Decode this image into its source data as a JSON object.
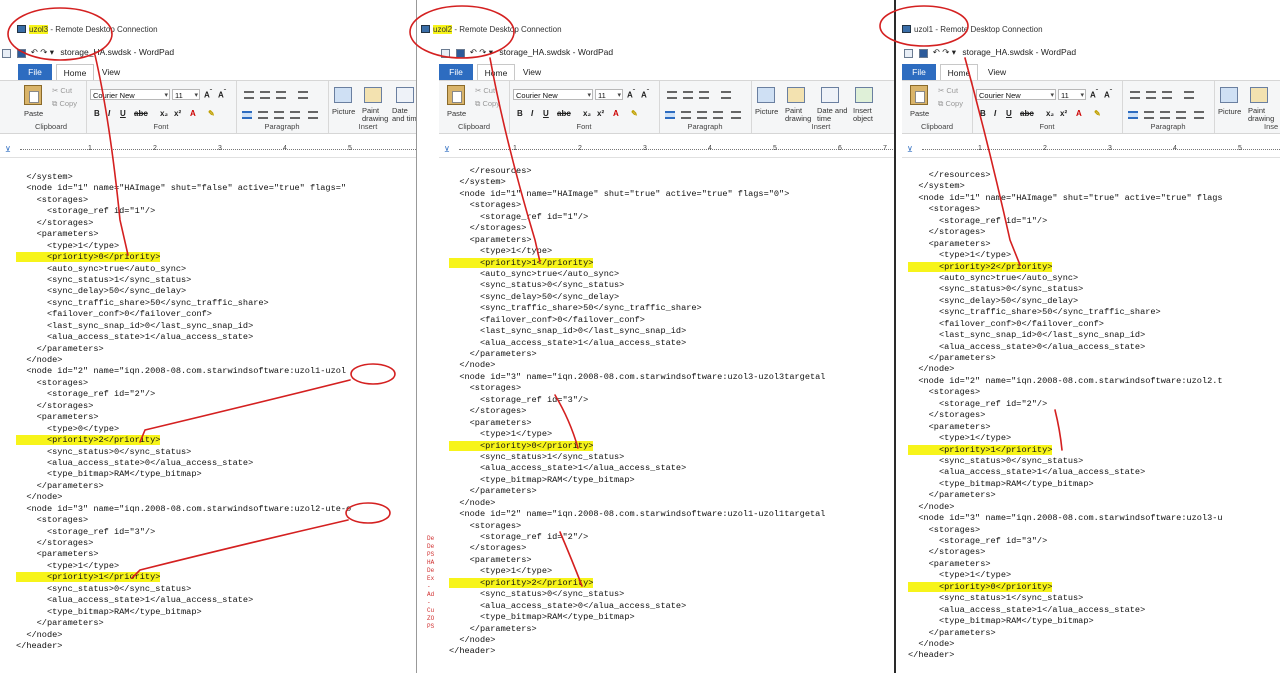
{
  "windows": [
    {
      "id": "w1",
      "rdp_title_host": "uzol3",
      "rdp_title_rest": " - Remote Desktop Connection",
      "wordpad_title": "storage_HA.swdsk - WordPad",
      "tabs": {
        "file": "File",
        "home": "Home",
        "view": "View"
      },
      "ribbon": {
        "clipboard": {
          "paste": "Paste",
          "cut": "Cut",
          "copy": "Copy",
          "label": "Clipboard"
        },
        "font": {
          "name": "Courier New",
          "size": "11",
          "label": "Font"
        },
        "paragraph": {
          "label": "Paragraph"
        },
        "insert": {
          "picture": "Picture",
          "paint": "Paint drawing",
          "datetime": "Date and time",
          "label": "Insert"
        }
      },
      "ruler_numbers": [
        "1",
        "2",
        "3",
        "4",
        "5"
      ],
      "lines": [
        {
          "text": "  </system>",
          "hl": false
        },
        {
          "text": "  <node id=\"1\" name=\"HAImage\" shut=\"false\" active=\"true\" flags=\"",
          "hl": false
        },
        {
          "text": "    <storages>",
          "hl": false
        },
        {
          "text": "      <storage_ref id=\"1\"/>",
          "hl": false
        },
        {
          "text": "    </storages>",
          "hl": false
        },
        {
          "text": "    <parameters>",
          "hl": false
        },
        {
          "text": "      <type>1</type>",
          "hl": false
        },
        {
          "text": "      <priority>0</priority>",
          "hl": true
        },
        {
          "text": "      <auto_sync>true</auto_sync>",
          "hl": false
        },
        {
          "text": "      <sync_status>1</sync_status>",
          "hl": false
        },
        {
          "text": "      <sync_delay>50</sync_delay>",
          "hl": false
        },
        {
          "text": "      <sync_traffic_share>50</sync_traffic_share>",
          "hl": false
        },
        {
          "text": "      <failover_conf>0</failover_conf>",
          "hl": false
        },
        {
          "text": "      <last_sync_snap_id>0</last_sync_snap_id>",
          "hl": false
        },
        {
          "text": "      <alua_access_state>1</alua_access_state>",
          "hl": false
        },
        {
          "text": "    </parameters>",
          "hl": false
        },
        {
          "text": "  </node>",
          "hl": false
        },
        {
          "text": "  <node id=\"2\" name=\"iqn.2008-08.com.starwindsoftware:uzol1-uzol",
          "hl": false
        },
        {
          "text": "    <storages>",
          "hl": false
        },
        {
          "text": "      <storage_ref id=\"2\"/>",
          "hl": false
        },
        {
          "text": "    </storages>",
          "hl": false
        },
        {
          "text": "    <parameters>",
          "hl": false
        },
        {
          "text": "      <type>0</type>",
          "hl": false
        },
        {
          "text": "      <priority>2</priority>",
          "hl": true
        },
        {
          "text": "      <sync_status>0</sync_status>",
          "hl": false
        },
        {
          "text": "      <alua_access_state>0</alua_access_state>",
          "hl": false
        },
        {
          "text": "      <type_bitmap>RAM</type_bitmap>",
          "hl": false
        },
        {
          "text": "    </parameters>",
          "hl": false
        },
        {
          "text": "  </node>",
          "hl": false
        },
        {
          "text": "  <node id=\"3\" name=\"iqn.2008-08.com.starwindsoftware:uzol2-ute-o",
          "hl": false
        },
        {
          "text": "    <storages>",
          "hl": false
        },
        {
          "text": "      <storage_ref id=\"3\"/>",
          "hl": false
        },
        {
          "text": "    </storages>",
          "hl": false
        },
        {
          "text": "    <parameters>",
          "hl": false
        },
        {
          "text": "      <type>1</type>",
          "hl": false
        },
        {
          "text": "      <priority>1</priority>",
          "hl": true
        },
        {
          "text": "      <sync_status>0</sync_status>",
          "hl": false
        },
        {
          "text": "      <alua_access_state>1</alua_access_state>",
          "hl": false
        },
        {
          "text": "      <type_bitmap>RAM</type_bitmap>",
          "hl": false
        },
        {
          "text": "    </parameters>",
          "hl": false
        },
        {
          "text": "  </node>",
          "hl": false
        },
        {
          "text": "</header>",
          "hl": false
        }
      ]
    },
    {
      "id": "w2",
      "rdp_title_host": "uzol2",
      "rdp_title_rest": " - Remote Desktop Connection",
      "wordpad_title": "storage_HA.swdsk - WordPad",
      "tabs": {
        "file": "File",
        "home": "Home",
        "view": "View"
      },
      "ribbon": {
        "clipboard": {
          "paste": "Paste",
          "cut": "Cut",
          "copy": "Copy",
          "label": "Clipboard"
        },
        "font": {
          "name": "Courier New",
          "size": "11",
          "label": "Font"
        },
        "paragraph": {
          "label": "Paragraph"
        },
        "insert": {
          "picture": "Picture",
          "paint": "Paint drawing",
          "datetime": "Date and time",
          "object": "Insert object",
          "label": "Insert"
        }
      },
      "ruler_numbers": [
        "1",
        "2",
        "3",
        "4",
        "5",
        "6",
        "7"
      ],
      "lines": [
        {
          "text": "    </resources>",
          "hl": false
        },
        {
          "text": "  </system>",
          "hl": false
        },
        {
          "text": "  <node id=\"1\" name=\"HAImage\" shut=\"true\" active=\"true\" flags=\"0\">",
          "hl": false
        },
        {
          "text": "    <storages>",
          "hl": false
        },
        {
          "text": "      <storage_ref id=\"1\"/>",
          "hl": false
        },
        {
          "text": "    </storages>",
          "hl": false
        },
        {
          "text": "    <parameters>",
          "hl": false
        },
        {
          "text": "      <type>1</type>",
          "hl": false
        },
        {
          "text": "      <priority>1</priority>",
          "hl": true
        },
        {
          "text": "      <auto_sync>true</auto_sync>",
          "hl": false
        },
        {
          "text": "      <sync_status>0</sync_status>",
          "hl": false
        },
        {
          "text": "      <sync_delay>50</sync_delay>",
          "hl": false
        },
        {
          "text": "      <sync_traffic_share>50</sync_traffic_share>",
          "hl": false
        },
        {
          "text": "      <failover_conf>0</failover_conf>",
          "hl": false
        },
        {
          "text": "      <last_sync_snap_id>0</last_sync_snap_id>",
          "hl": false
        },
        {
          "text": "      <alua_access_state>1</alua_access_state>",
          "hl": false
        },
        {
          "text": "    </parameters>",
          "hl": false
        },
        {
          "text": "  </node>",
          "hl": false
        },
        {
          "text": "  <node id=\"3\" name=\"iqn.2008-08.com.starwindsoftware:uzol3-uzol3targetal",
          "hl": false
        },
        {
          "text": "    <storages>",
          "hl": false
        },
        {
          "text": "      <storage_ref id=\"3\"/>",
          "hl": false
        },
        {
          "text": "    </storages>",
          "hl": false
        },
        {
          "text": "    <parameters>",
          "hl": false
        },
        {
          "text": "      <type>1</type>",
          "hl": false
        },
        {
          "text": "      <priority>0</priority>",
          "hl": true
        },
        {
          "text": "      <sync_status>1</sync_status>",
          "hl": false
        },
        {
          "text": "      <alua_access_state>1</alua_access_state>",
          "hl": false
        },
        {
          "text": "      <type_bitmap>RAM</type_bitmap>",
          "hl": false
        },
        {
          "text": "    </parameters>",
          "hl": false
        },
        {
          "text": "  </node>",
          "hl": false
        },
        {
          "text": "  <node id=\"2\" name=\"iqn.2008-08.com.starwindsoftware:uzol1-uzol1targetal",
          "hl": false
        },
        {
          "text": "    <storages>",
          "hl": false
        },
        {
          "text": "      <storage_ref id=\"2\"/>",
          "hl": false
        },
        {
          "text": "    </storages>",
          "hl": false
        },
        {
          "text": "    <parameters>",
          "hl": false
        },
        {
          "text": "      <type>1</type>",
          "hl": false
        },
        {
          "text": "      <priority>2</priority>",
          "hl": true
        },
        {
          "text": "      <sync_status>0</sync_status>",
          "hl": false
        },
        {
          "text": "      <alua_access_state>0</alua_access_state>",
          "hl": false
        },
        {
          "text": "      <type_bitmap>RAM</type_bitmap>",
          "hl": false
        },
        {
          "text": "    </parameters>",
          "hl": false
        },
        {
          "text": "  </node>",
          "hl": false
        },
        {
          "text": "</header>",
          "hl": false
        }
      ]
    },
    {
      "id": "w3",
      "rdp_title_host": "uzol1",
      "rdp_title_rest": " - Remote Desktop Connection",
      "wordpad_title": "storage_HA.swdsk - WordPad",
      "tabs": {
        "file": "File",
        "home": "Home",
        "view": "View"
      },
      "ribbon": {
        "clipboard": {
          "paste": "Paste",
          "cut": "Cut",
          "copy": "Copy",
          "label": "Clipboard"
        },
        "font": {
          "name": "Courier New",
          "size": "11",
          "label": "Font"
        },
        "paragraph": {
          "label": "Paragraph"
        },
        "insert": {
          "picture": "Picture",
          "paint": "Paint drawing",
          "label": "Inse"
        }
      },
      "ruler_numbers": [
        "1",
        "2",
        "3",
        "4",
        "5"
      ],
      "lines": [
        {
          "text": "    </resources>",
          "hl": false
        },
        {
          "text": "  </system>",
          "hl": false
        },
        {
          "text": "  <node id=\"1\" name=\"HAImage\" shut=\"true\" active=\"true\" flags",
          "hl": false
        },
        {
          "text": "    <storages>",
          "hl": false
        },
        {
          "text": "      <storage_ref id=\"1\"/>",
          "hl": false
        },
        {
          "text": "    </storages>",
          "hl": false
        },
        {
          "text": "    <parameters>",
          "hl": false
        },
        {
          "text": "      <type>1</type>",
          "hl": false
        },
        {
          "text": "      <priority>2</priority>",
          "hl": true
        },
        {
          "text": "      <auto_sync>true</auto_sync>",
          "hl": false
        },
        {
          "text": "      <sync_status>0</sync_status>",
          "hl": false
        },
        {
          "text": "      <sync_delay>50</sync_delay>",
          "hl": false
        },
        {
          "text": "      <sync_traffic_share>50</sync_traffic_share>",
          "hl": false
        },
        {
          "text": "      <failover_conf>0</failover_conf>",
          "hl": false
        },
        {
          "text": "      <last_sync_snap_id>0</last_sync_snap_id>",
          "hl": false
        },
        {
          "text": "      <alua_access_state>0</alua_access_state>",
          "hl": false
        },
        {
          "text": "    </parameters>",
          "hl": false
        },
        {
          "text": "  </node>",
          "hl": false
        },
        {
          "text": "  <node id=\"2\" name=\"iqn.2008-08.com.starwindsoftware:uzol2.t",
          "hl": false
        },
        {
          "text": "    <storages>",
          "hl": false
        },
        {
          "text": "      <storage_ref id=\"2\"/>",
          "hl": false
        },
        {
          "text": "    </storages>",
          "hl": false
        },
        {
          "text": "    <parameters>",
          "hl": false
        },
        {
          "text": "      <type>1</type>",
          "hl": false
        },
        {
          "text": "      <priority>1</priority>",
          "hl": true
        },
        {
          "text": "      <sync_status>0</sync_status>",
          "hl": false
        },
        {
          "text": "      <alua_access_state>1</alua_access_state>",
          "hl": false
        },
        {
          "text": "      <type_bitmap>RAM</type_bitmap>",
          "hl": false
        },
        {
          "text": "    </parameters>",
          "hl": false
        },
        {
          "text": "  </node>",
          "hl": false
        },
        {
          "text": "  <node id=\"3\" name=\"iqn.2008-08.com.starwindsoftware:uzol3-u",
          "hl": false
        },
        {
          "text": "    <storages>",
          "hl": false
        },
        {
          "text": "      <storage_ref id=\"3\"/>",
          "hl": false
        },
        {
          "text": "    </storages>",
          "hl": false
        },
        {
          "text": "    <parameters>",
          "hl": false
        },
        {
          "text": "      <type>1</type>",
          "hl": false
        },
        {
          "text": "      <priority>0</priority>",
          "hl": true
        },
        {
          "text": "      <sync_status>1</sync_status>",
          "hl": false
        },
        {
          "text": "      <alua_access_state>1</alua_access_state>",
          "hl": false
        },
        {
          "text": "      <type_bitmap>RAM</type_bitmap>",
          "hl": false
        },
        {
          "text": "    </parameters>",
          "hl": false
        },
        {
          "text": "  </node>",
          "hl": false
        },
        {
          "text": "</header>",
          "hl": false
        }
      ]
    }
  ],
  "background_console": {
    "lines": [
      "De",
      "De",
      "PS",
      "HA",
      "De",
      "Ex",
      "-",
      "Ad",
      "-",
      "Cu",
      "ZO",
      "PS"
    ]
  },
  "colors": {
    "highlight": "#f7f41a",
    "annotation": "#d42020",
    "file_tab": "#2d6cc0"
  }
}
